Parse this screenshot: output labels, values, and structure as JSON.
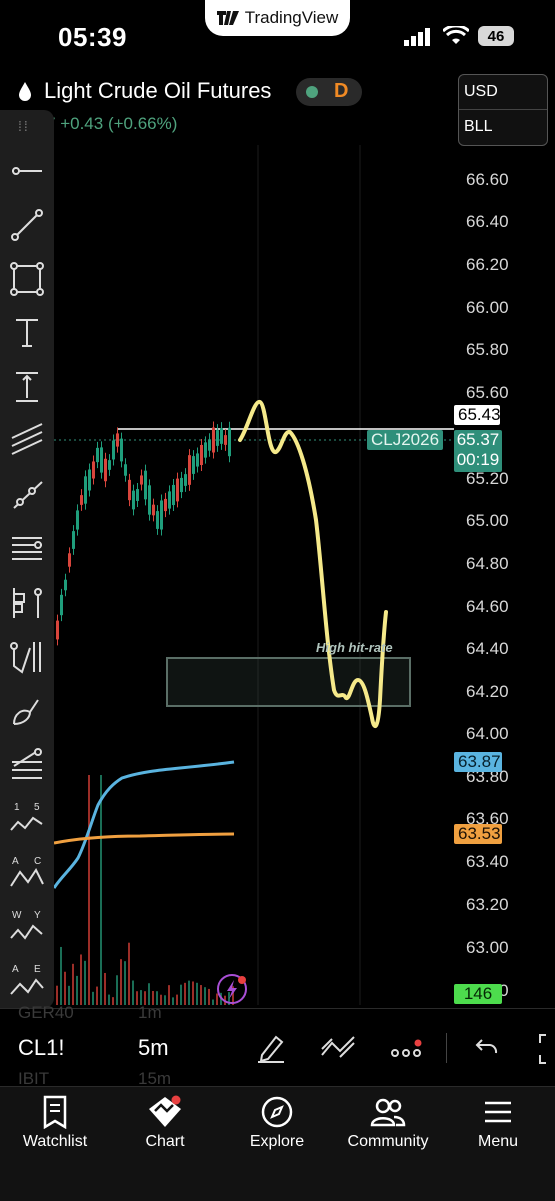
{
  "status": {
    "time": "05:39",
    "app_pill": "TradingView",
    "battery": "46"
  },
  "header": {
    "symbol_name": "Light Crude Oil Futures",
    "badge_letter": "D",
    "change_partial": "7",
    "change": "+0.43 (+0.66%)",
    "currency": "USD",
    "unit": "BLL"
  },
  "chart": {
    "price_axis": [
      "66.60",
      "66.40",
      "66.20",
      "66.00",
      "65.80",
      "65.60",
      "65.20",
      "65.00",
      "64.80",
      "64.60",
      "64.40",
      "64.20",
      "64.00",
      "63.80",
      "63.60",
      "63.40",
      "63.20",
      "63.00",
      "62.80"
    ],
    "price_tag_white": "65.43",
    "contract_tag": "CLJ2026",
    "last_price": "65.37",
    "countdown": "00:19",
    "ma_blue_value": "63.87",
    "ma_orange_value": "63.53",
    "volume_value": "146",
    "annotation": "High hit-rate",
    "colors": {
      "up": "#1f9e7c",
      "down": "#d8453c",
      "blue_ma": "#5ab4e0",
      "orange_ma": "#f0a040",
      "drawing": "#f5e98a",
      "volume_tag": "#4ddc4d"
    }
  },
  "bottom_toolbar": {
    "ghost_top": "GER40",
    "ghost_top_tf": "1m",
    "symbol": "CL1!",
    "timeframe": "5m",
    "ghost_bottom": "IBIT",
    "ghost_bottom_tf": "15m"
  },
  "nav": {
    "watchlist": "Watchlist",
    "chart": "Chart",
    "explore": "Explore",
    "community": "Community",
    "menu": "Menu"
  }
}
